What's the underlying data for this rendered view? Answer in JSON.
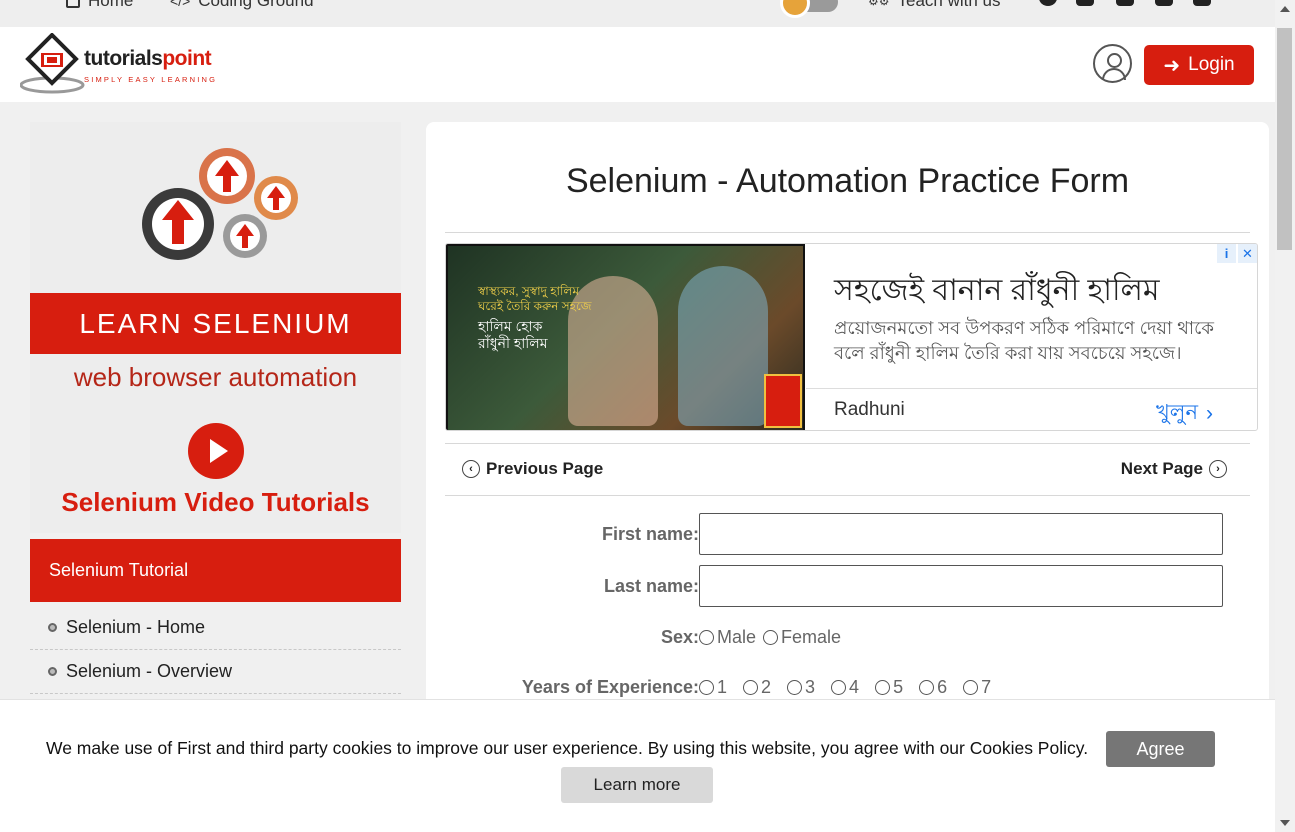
{
  "topbar": {
    "home_label": "Home",
    "coding_ground_label": "Coding Ground",
    "teach_label": "Teach with us"
  },
  "header": {
    "logo_word_1": "tutorials",
    "logo_word_2": "point",
    "logo_tagline": "SIMPLY EASY LEARNING",
    "login_label": "Login",
    "accent_color": "#d71e0f"
  },
  "sidebar": {
    "learn_banner": "LEARN SELENIUM",
    "banner_sub": "web browser automation",
    "video_label": "Selenium Video Tutorials",
    "tutorial_heading": "Selenium Tutorial",
    "links": [
      {
        "label": "Selenium - Home"
      },
      {
        "label": "Selenium - Overview"
      }
    ]
  },
  "main": {
    "title": "Selenium - Automation Practice Form",
    "prev_label": "Previous Page",
    "next_label": "Next Page"
  },
  "ad": {
    "image_line_1": "স্বাস্থ্যকর, সুস্বাদু হালিম ঘরেই তৈরি করুন সহজে",
    "image_line_2": "হালিম হোক রাঁধুনী হালিম",
    "headline": "সহজেই বানান রাঁধুনী হালিম",
    "body": "প্রয়োজনমতো সব উপকরণ সঠিক পরিমাণে দেয়া থাকে বলে রাঁধুনী হালিম তৈরি করা যায় সবচেয়ে সহজে।",
    "brand": "Radhuni",
    "open_label": "খুলুন"
  },
  "form": {
    "first_name_label": "First name:",
    "last_name_label": "Last name:",
    "sex_label": "Sex:",
    "sex_options": [
      "Male",
      "Female"
    ],
    "experience_label": "Years of Experience:",
    "experience_options": [
      "1",
      "2",
      "3",
      "4",
      "5",
      "6",
      "7"
    ]
  },
  "cookie": {
    "text": "We make use of First and third party cookies to improve our user experience. By using this website, you agree with our Cookies Policy.",
    "agree_label": "Agree",
    "learn_more_label": "Learn more"
  }
}
